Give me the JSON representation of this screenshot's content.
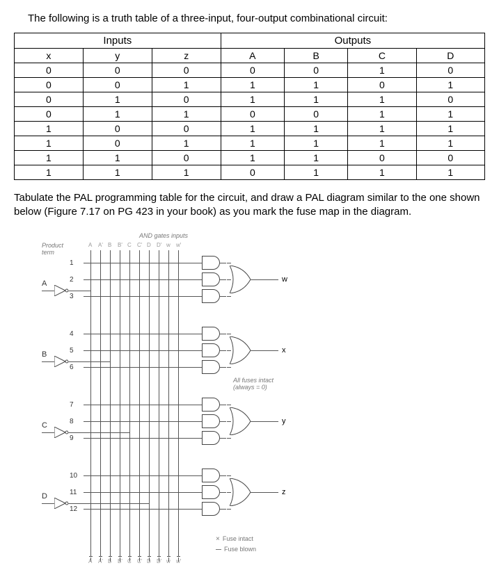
{
  "intro": "The following is a truth table of a three-input, four-output combinational circuit:",
  "table": {
    "section_inputs": "Inputs",
    "section_outputs": "Outputs",
    "headers": [
      "x",
      "y",
      "z",
      "A",
      "B",
      "C",
      "D"
    ],
    "rows": [
      [
        "0",
        "0",
        "0",
        "0",
        "0",
        "1",
        "0"
      ],
      [
        "0",
        "0",
        "1",
        "1",
        "1",
        "0",
        "1"
      ],
      [
        "0",
        "1",
        "0",
        "1",
        "1",
        "1",
        "0"
      ],
      [
        "0",
        "1",
        "1",
        "0",
        "0",
        "1",
        "1"
      ],
      [
        "1",
        "0",
        "0",
        "1",
        "1",
        "1",
        "1"
      ],
      [
        "1",
        "0",
        "1",
        "1",
        "1",
        "1",
        "1"
      ],
      [
        "1",
        "1",
        "0",
        "1",
        "1",
        "0",
        "0"
      ],
      [
        "1",
        "1",
        "1",
        "0",
        "1",
        "1",
        "1"
      ]
    ]
  },
  "instruction": "Tabulate the PAL programming table for the circuit, and draw a PAL diagram similar to the one shown below (Figure 7.17 on PG 423 in your book) as you mark the fuse map in the diagram.",
  "diagram": {
    "top_label": "AND gates inputs",
    "side_label_top": "Product term",
    "col_labels": [
      "A",
      "A'",
      "B",
      "B'",
      "C",
      "C'",
      "D",
      "D'",
      "w",
      "w'"
    ],
    "product_numbers": [
      "1",
      "2",
      "3",
      "4",
      "5",
      "6",
      "7",
      "8",
      "9",
      "10",
      "11",
      "12"
    ],
    "input_labels": [
      "A",
      "B",
      "C",
      "D"
    ],
    "output_labels": [
      "w",
      "x",
      "y",
      "z"
    ],
    "mid_label": "All fuses intact (always = 0)",
    "legend1": "Fuse intact",
    "legend2": "Fuse blown"
  }
}
